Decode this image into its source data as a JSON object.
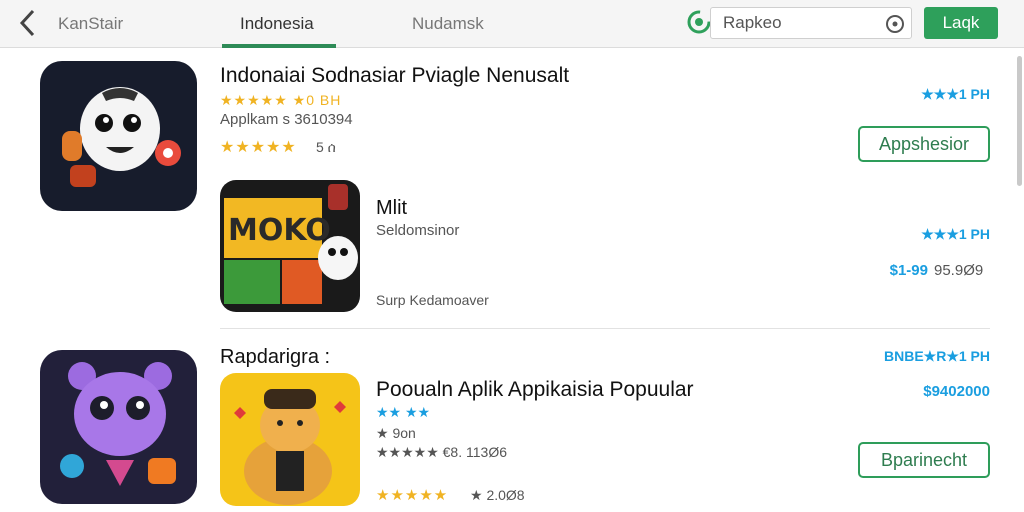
{
  "header": {
    "back_icon": "chevron-left-icon",
    "title": "KanStair",
    "tabs": [
      {
        "label": "Indonesia",
        "active": true
      },
      {
        "label": "Nudamsk",
        "active": false
      }
    ],
    "search": {
      "value": "Rapkeo",
      "logo_icon": "play-store-icon",
      "clock_icon": "clock-icon"
    },
    "action_button": "Laqk"
  },
  "apps": [
    {
      "title": "Indonaiai Sodnasiar Pviagle Nenusalt",
      "rating_line": "★★★★★ ★0 ВН",
      "meta": "Applkam s 3610394",
      "stars": "★★★★★",
      "review": "5 ሰ",
      "right_label": "★★★1 PH",
      "button": "Appshesior"
    },
    {
      "title": "Mlit",
      "subtitle": "Seldomsinor",
      "footer": "Surp Kedamoaver",
      "right_label": "★★★1 PH",
      "price": "$1-99",
      "price2": "95.9Ø9",
      "badge_text": "MOKO"
    },
    {
      "section_title": "Rapdarigra :",
      "title": "Pooualn Aplik Appikaisia Popuular",
      "line1": "★★ ★★",
      "line2": "★ 9on",
      "line3": "★★★★★ €8. 113Ø6",
      "stars": "★★★★★",
      "footer": "★ 2.0Ø8",
      "right_label": "BNBE★R★1 PH",
      "price": "$9402000",
      "button": "Bparinecht"
    }
  ],
  "colors": {
    "accent": "#2ea05b",
    "link_blue": "#1a9ee0",
    "star": "#f0b323"
  }
}
